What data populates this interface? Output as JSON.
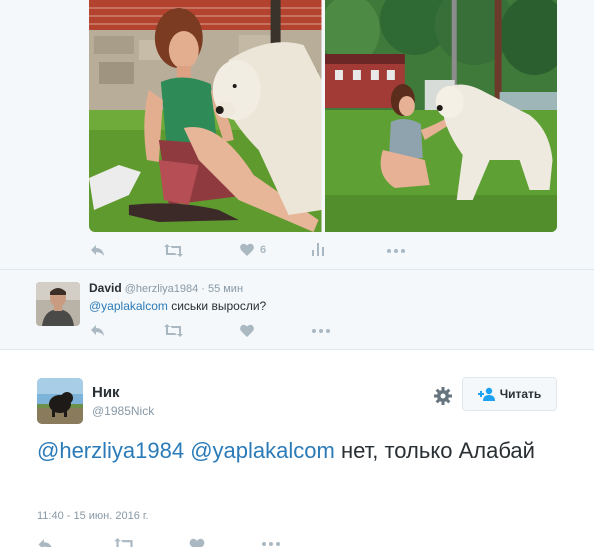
{
  "top_tweet": {
    "actions": {
      "reply_icon": "reply-icon",
      "retweet_icon": "retweet-icon",
      "like_icon": "heart-icon",
      "like_count": "6",
      "analytics_icon": "analytics-icon",
      "more_icon": "more-icon"
    }
  },
  "reply_tweet": {
    "author_name": "David",
    "author_handle": "@herzliya1984",
    "time_ago": "· 55 мин",
    "mention": "@yaplakalcom",
    "text": " сиськи выросли?"
  },
  "main_tweet": {
    "author_name": "Ник",
    "author_handle": "@1985Nick",
    "follow_label": "Читать",
    "mention1": "@herzliya1984",
    "mention2": "@yaplakalcom",
    "text": " нет, только Алабай",
    "timestamp": "11:40 - 15 июн. 2016 г."
  },
  "colors": {
    "link": "#2b7bb9",
    "muted": "#8899a6",
    "action": "#aab8c2",
    "bg_gray": "#f5f8fa"
  }
}
